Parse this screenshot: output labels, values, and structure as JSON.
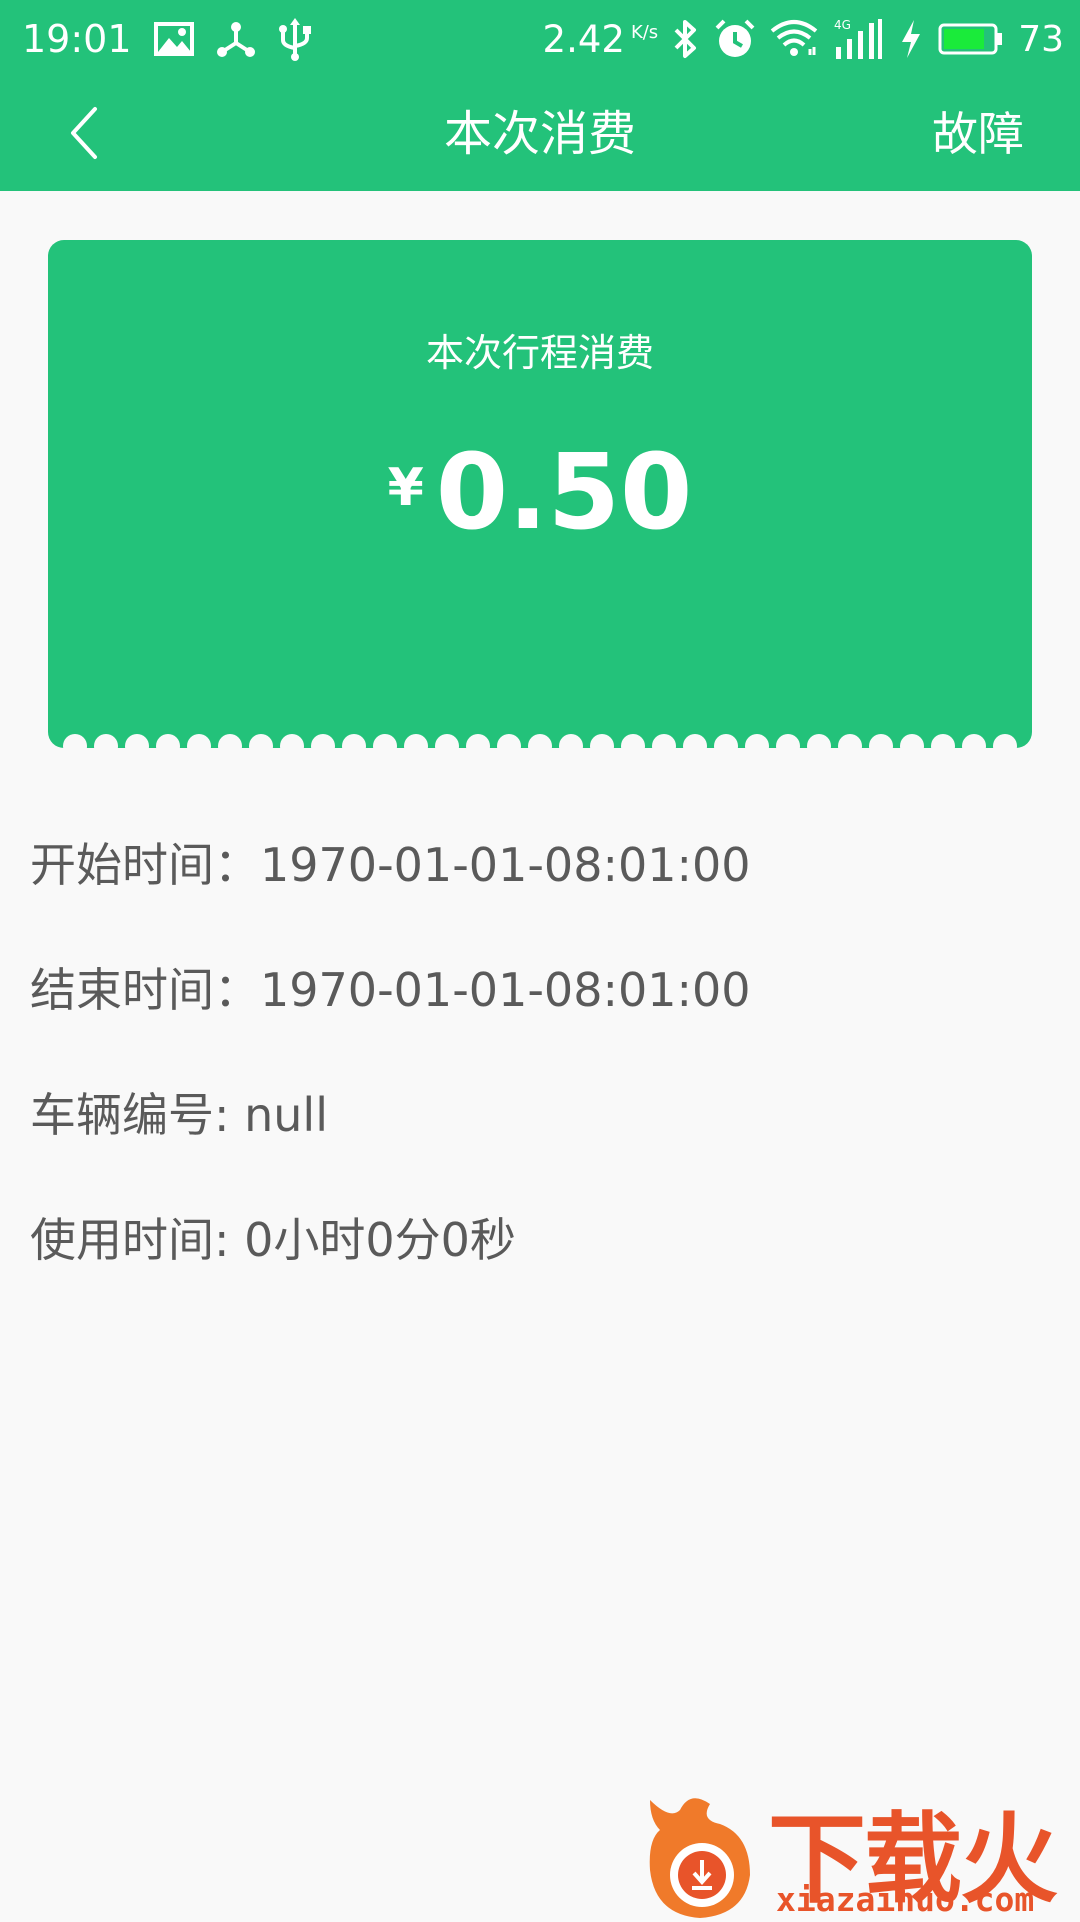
{
  "status_bar": {
    "time": "19:01",
    "net_speed": "2.42",
    "net_unit": "K/s",
    "battery_percent": "73",
    "icons_left": [
      "image-icon",
      "share-icon",
      "usb-icon"
    ],
    "icons_right": [
      "bluetooth-icon",
      "alarm-icon",
      "wifi-icon",
      "signal-4g-icon",
      "charging-icon",
      "battery-icon"
    ]
  },
  "nav": {
    "title": "本次消费",
    "action_label": "故障",
    "back_icon": "chevron-left-icon"
  },
  "fare_card": {
    "label": "本次行程消费",
    "currency": "¥",
    "amount": "0.50"
  },
  "details": {
    "start": "开始时间：1970-01-01-08:01:00",
    "end": "结束时间：1970-01-01-08:01:00",
    "vehicle": "车辆编号: null",
    "duration": "使用时间: 0小时0分0秒"
  },
  "watermark": {
    "brand": "下载火",
    "url": "xiazaihuo.com"
  },
  "colors": {
    "primary": "#23c27a",
    "background": "#f9f9f9",
    "text": "#5a5a5a",
    "watermark": "#e8542a"
  }
}
